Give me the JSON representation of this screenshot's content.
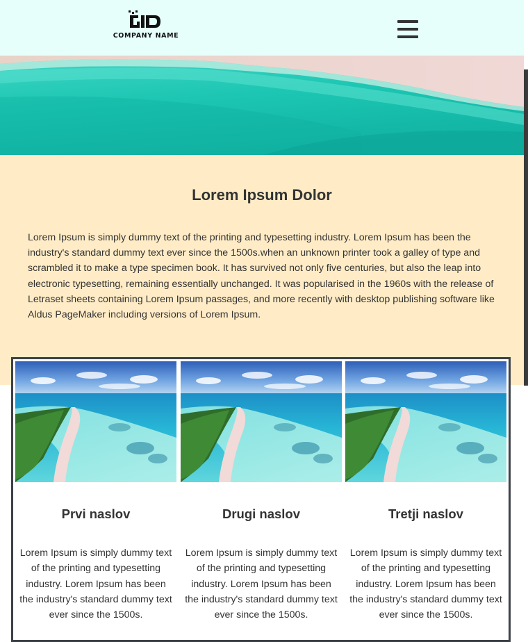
{
  "header": {
    "company_name": "COMPANY NAME",
    "logo_icon": "company-logo",
    "menu_icon": "hamburger-menu-icon",
    "background": "#e6fffb"
  },
  "intro": {
    "title": "Lorem Ipsum Dolor",
    "body": "Lorem Ipsum is simply dummy text of the printing and typesetting industry. Lorem Ipsum has been the industry's standard dummy text ever since the 1500s.when an unknown printer took a galley of type and scrambled it to make a type specimen book. It has survived not only five centuries, but also the leap into electronic typesetting, remaining essentially unchanged. It was popularised in the 1960s with the release of Letraset sheets containing Lorem Ipsum passages, and more recently with desktop publishing software like Aldus PageMaker including versions of Lorem Ipsum.",
    "background": "#ffecc6"
  },
  "cards": [
    {
      "title": "Prvi naslov",
      "text": "Lorem Ipsum is simply dummy text of the printing and typesetting industry. Lorem Ipsum has been the industry's standard dummy text ever since the 1500s."
    },
    {
      "title": "Drugi naslov",
      "text": "Lorem Ipsum is simply dummy text of the printing and typesetting industry. Lorem Ipsum has been the industry's standard dummy text ever since the 1500s."
    },
    {
      "title": "Tretji naslov",
      "text": "Lorem Ipsum is simply dummy text of the printing and typesetting industry. Lorem Ipsum has been the industry's standard dummy text ever since the 1500s."
    }
  ]
}
